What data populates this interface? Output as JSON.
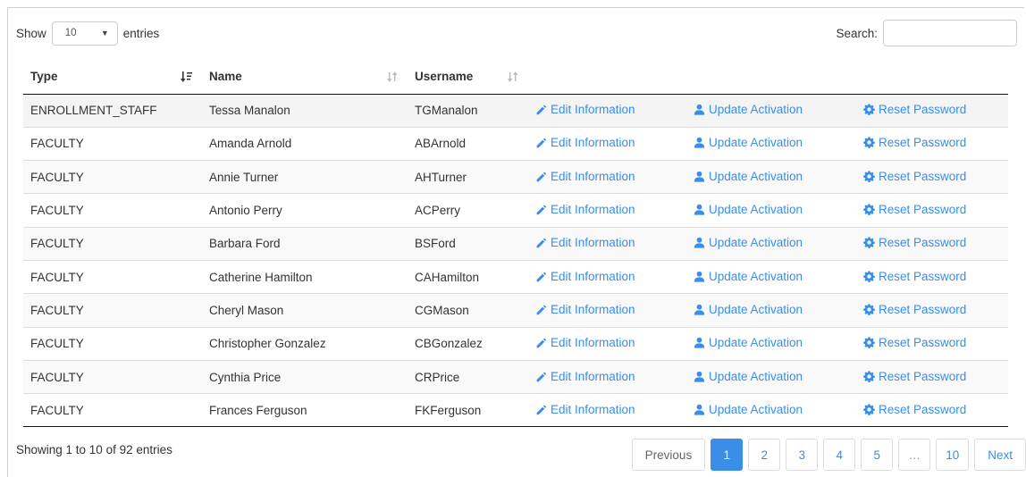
{
  "length_menu": {
    "show_label": "Show",
    "value": "10",
    "entries_label": "entries"
  },
  "search": {
    "label": "Search:",
    "value": "",
    "placeholder": ""
  },
  "table": {
    "headers": [
      "Type",
      "Name",
      "Username"
    ],
    "rows": [
      {
        "type": "ENROLLMENT_STAFF",
        "name": "Tessa Manalon",
        "username": "TGManalon"
      },
      {
        "type": "FACULTY",
        "name": "Amanda Arnold",
        "username": "ABArnold"
      },
      {
        "type": "FACULTY",
        "name": "Annie Turner",
        "username": "AHTurner"
      },
      {
        "type": "FACULTY",
        "name": "Antonio Perry",
        "username": "ACPerry"
      },
      {
        "type": "FACULTY",
        "name": "Barbara Ford",
        "username": "BSFord"
      },
      {
        "type": "FACULTY",
        "name": "Catherine Hamilton",
        "username": "CAHamilton"
      },
      {
        "type": "FACULTY",
        "name": "Cheryl Mason",
        "username": "CGMason"
      },
      {
        "type": "FACULTY",
        "name": "Christopher Gonzalez",
        "username": "CBGonzalez"
      },
      {
        "type": "FACULTY",
        "name": "Cynthia Price",
        "username": "CRPrice"
      },
      {
        "type": "FACULTY",
        "name": "Frances Ferguson",
        "username": "FKFerguson"
      }
    ],
    "actions": {
      "edit_label": "Edit Information",
      "activation_label": "Update Activation",
      "reset_label": "Reset Password"
    }
  },
  "footer": {
    "info": "Showing 1 to 10 of 92 entries",
    "pagination": {
      "previous": "Previous",
      "pages": [
        "1",
        "2",
        "3",
        "4",
        "5",
        "…",
        "10"
      ],
      "active_page": "1",
      "next": "Next"
    }
  },
  "colors": {
    "link": "#3a8ee6",
    "active_page_bg": "#3a8ee6"
  },
  "icons": {
    "edit": "pencil-icon",
    "activation": "user-icon",
    "reset": "gear-icon"
  }
}
